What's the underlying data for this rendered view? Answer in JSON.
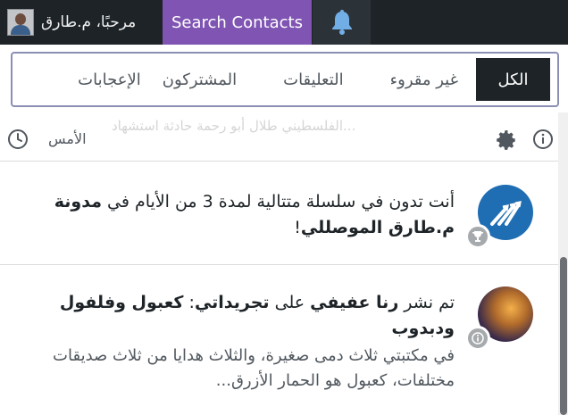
{
  "topbar": {
    "greeting": "مرحبًا، م.طارق",
    "search_contacts": "Search Contacts"
  },
  "tabs": [
    {
      "label": "الكل",
      "active": true
    },
    {
      "label": "غير مقروء"
    },
    {
      "label": "التعليقات"
    },
    {
      "label": "المشتركون"
    },
    {
      "label": "الإعجابات"
    }
  ],
  "feed": {
    "previous_excerpt": "...الفلسطيني طلال أبو رحمة حادثة استشهاد",
    "date_label": "الأمس"
  },
  "notifications": [
    {
      "text_1": "أنت تدون في سلسلة متتالية لمدة 3 من الأيام في",
      "blog_name": "مدونة م.طارق الموصللي",
      "text_end": "!",
      "badge": "trophy-icon"
    },
    {
      "prefix": "تم نشر ",
      "author": "رنا عفيفي",
      "middle": " على ",
      "site": "تجريداتي",
      "colon": ": ",
      "post_title": "كعبول وفلفول ودبدوب",
      "excerpt": "في مكتبتي ثلاث دمى صغيرة، والثلاث هدايا من ثلاث صديقات مختلفات، كعبول هو الحمار الأزرق...",
      "badge": "info-icon"
    }
  ],
  "colors": {
    "admin_bar": "#1d2327",
    "search_accent": "#7f54b3",
    "active_tab": "#1d2327",
    "streak_avatar": "#1f6db3"
  }
}
